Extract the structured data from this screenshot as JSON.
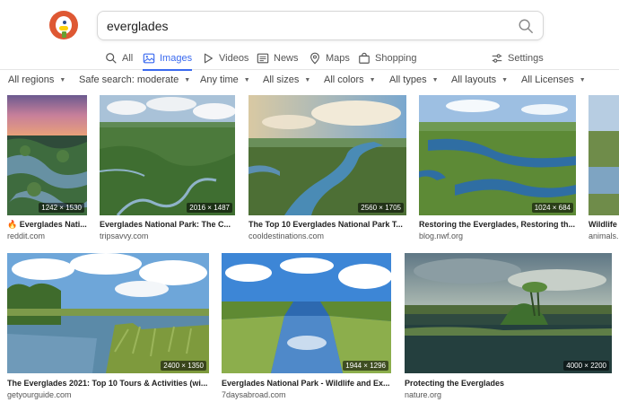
{
  "search": {
    "query": "everglades"
  },
  "tabs": [
    {
      "label": "All",
      "icon": "search-icon"
    },
    {
      "label": "Images",
      "icon": "image-icon",
      "active": true
    },
    {
      "label": "Videos",
      "icon": "play-icon"
    },
    {
      "label": "News",
      "icon": "newspaper-icon"
    },
    {
      "label": "Maps",
      "icon": "map-pin-icon"
    },
    {
      "label": "Shopping",
      "icon": "shopping-bag-icon"
    },
    {
      "label": "Settings",
      "icon": "settings-sliders-icon"
    }
  ],
  "filters": [
    "All regions",
    "Safe search: moderate",
    "Any time",
    "All sizes",
    "All colors",
    "All types",
    "All layouts",
    "All Licenses"
  ],
  "results": [
    {
      "title": "Everglades Nati...",
      "prefix_emoji": "🔥",
      "domain": "reddit.com",
      "dims": "1242 × 1530"
    },
    {
      "title": "Everglades National Park: The C...",
      "domain": "tripsavvy.com",
      "dims": "2016 × 1487"
    },
    {
      "title": "The Top 10 Everglades National Park T...",
      "domain": "cooldestinations.com",
      "dims": "2560 × 1705"
    },
    {
      "title": "Restoring the Everglades, Restoring th...",
      "domain": "blog.nwf.org",
      "dims": "1024 × 684"
    },
    {
      "title": "Wildlife",
      "domain": "animals...",
      "dims": ""
    },
    {
      "title": "The Everglades 2021: Top 10 Tours & Activities (wi...",
      "domain": "getyourguide.com",
      "dims": "2400 × 1350"
    },
    {
      "title": "Everglades National Park - Wildlife and Ex...",
      "domain": "7daysabroad.com",
      "dims": "1944 × 1296"
    },
    {
      "title": "Protecting the Everglades",
      "domain": "nature.org",
      "dims": "4000 × 2200"
    }
  ],
  "colors": {
    "accent": "#3969ef",
    "logo": "#de5833"
  }
}
